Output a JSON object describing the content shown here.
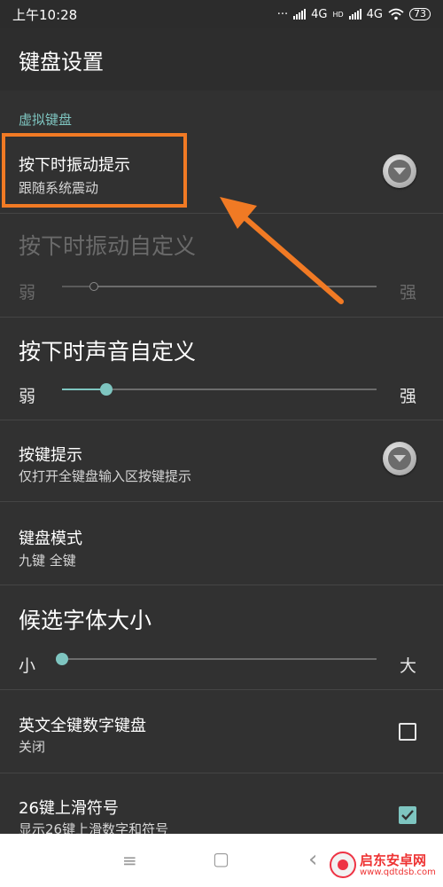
{
  "status_bar": {
    "time": "上午10:28",
    "dots": "···",
    "network1": "4G",
    "hd": "HD",
    "network2": "4G",
    "battery": "73"
  },
  "app_bar": {
    "title": "键盘设置"
  },
  "section": {
    "title": "虚拟键盘"
  },
  "settings": {
    "vibrate": {
      "title": "按下时振动提示",
      "subtitle": "跟随系统震动"
    },
    "vibrate_custom": {
      "title": "按下时振动自定义",
      "min_label": "弱",
      "max_label": "强",
      "value_fraction": 0.1,
      "enabled": false
    },
    "sound_custom": {
      "title": "按下时声音自定义",
      "min_label": "弱",
      "max_label": "强",
      "value_fraction": 0.14,
      "enabled": true
    },
    "key_hint": {
      "title": "按键提示",
      "subtitle": "仅打开全键盘输入区按键提示"
    },
    "keyboard_mode": {
      "title": "键盘模式",
      "subtitle": "九键 全键"
    },
    "candidate_font": {
      "title": "候选字体大小",
      "min_label": "小",
      "max_label": "大",
      "value_fraction": 0.0
    },
    "english_numeric": {
      "title": "英文全键数字键盘",
      "subtitle": "关闭",
      "checked": false
    },
    "swipe_symbols": {
      "title": "26键上滑符号",
      "subtitle": "显示26键上滑数字和符号",
      "checked": true
    }
  },
  "nav_bar": {
    "menu_icon": "≡",
    "home_icon": "▢",
    "back_icon": "‹"
  },
  "watermark": {
    "title": "启东安卓网",
    "url": "www.qdtdsb.com"
  },
  "colors": {
    "accent": "#7ec5c0",
    "highlight": "#f17a24",
    "background": "#313131"
  }
}
